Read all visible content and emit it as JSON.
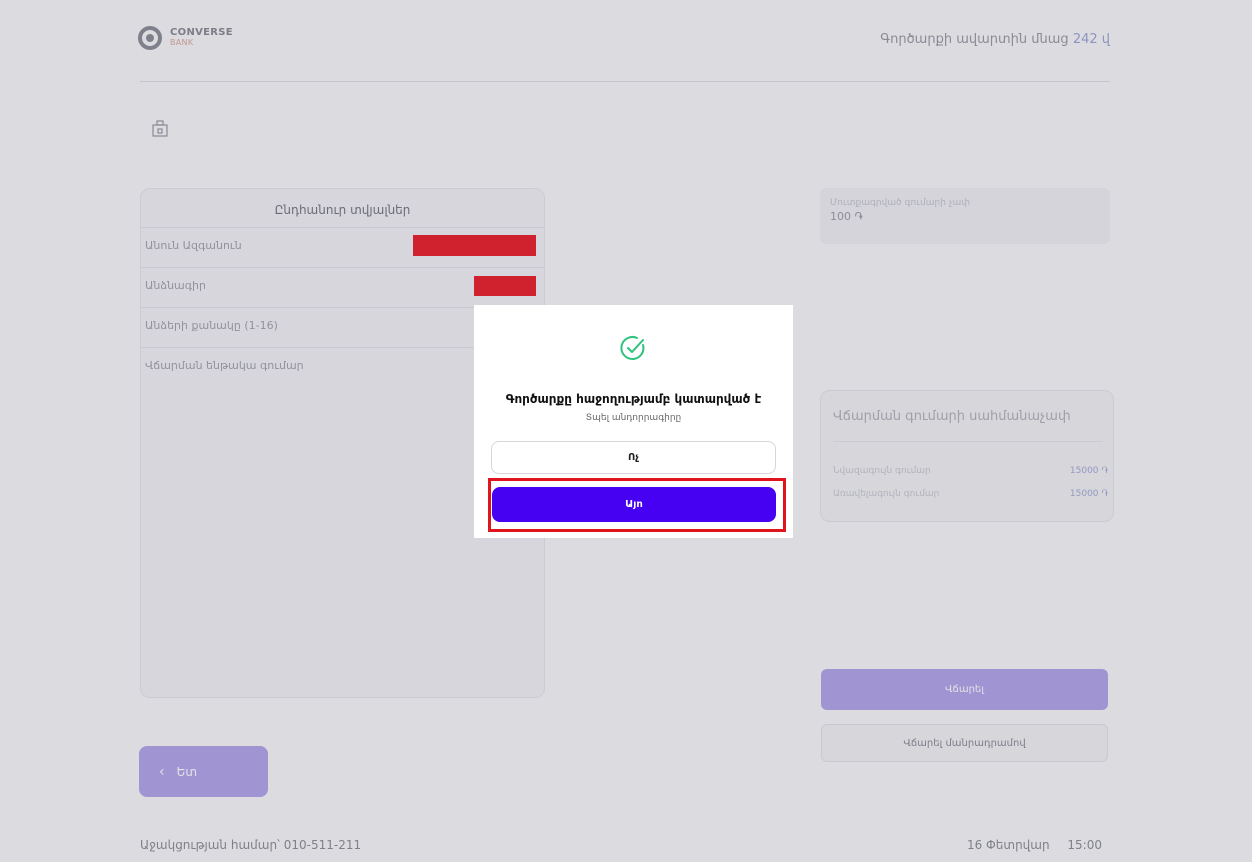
{
  "header": {
    "logo_name": "CONVERSE",
    "logo_sub": "BANK",
    "time_left_label": "Գործարքի ավարտին մնաց",
    "time_left_value": "242 վ"
  },
  "general_card": {
    "title": "Ընդհանուր տվյալներ",
    "rows": [
      {
        "label": "Անուն Ազգանուն"
      },
      {
        "label": "Անձնագիր"
      },
      {
        "label": "Անձերի քանակը (1-16)"
      },
      {
        "label": "Վճարման ենթակա գումար"
      }
    ]
  },
  "amount_box": {
    "label": "Մուտքագրված գումարի չափ",
    "value": "100 ֏"
  },
  "limit_card": {
    "title": "Վճարման գումարի սահմանաչափ",
    "min_label": "Նվազագույն գումար",
    "min_value": "15000 ֏",
    "max_label": "Առավելագույն գումար",
    "max_value": "15000 ֏"
  },
  "buttons": {
    "pay": "Վճարել",
    "pay_cash": "Վճարել մանրադրամով",
    "back": "Ետ"
  },
  "footer": {
    "support": "Աջակցության համար՝ 010-511-211",
    "date": "16 Փետրվար",
    "time": "15:00"
  },
  "modal": {
    "title": "Գործարքը հաջողությամբ կատարված է",
    "subtitle": "Տպել անդորրագիրը",
    "no_label": "Ոչ",
    "yes_label": "Այո"
  },
  "colors": {
    "accent": "#4600f2",
    "success": "#2ec27e",
    "highlight": "#e0141c",
    "redaction": "#e8222c"
  }
}
